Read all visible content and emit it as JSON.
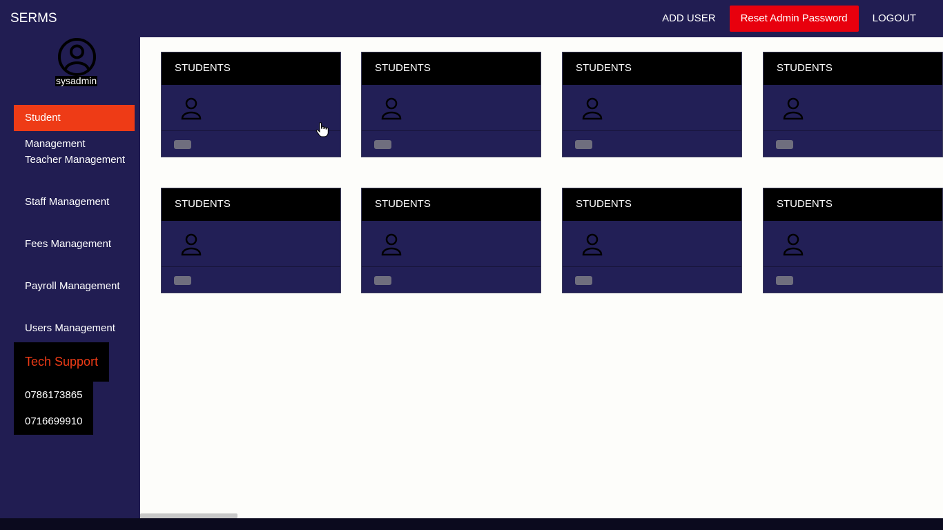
{
  "app": {
    "brand": "SERMS"
  },
  "header": {
    "add_user": "ADD USER",
    "reset_password": "Reset Admin Password",
    "logout": "LOGOUT"
  },
  "sidebar": {
    "username": "sysadmin",
    "items": [
      {
        "label": "Student Management",
        "active": true
      },
      {
        "label": "Teacher Management"
      },
      {
        "label": "Staff Management"
      },
      {
        "label": "Fees Management"
      },
      {
        "label": "Payroll Management"
      },
      {
        "label": "Users Management"
      }
    ],
    "tech_support": {
      "title": "Tech Support",
      "phones": [
        "0786173865",
        "0716699910"
      ]
    }
  },
  "cards": [
    {
      "title": "STUDENTS",
      "icon": "user-icon"
    },
    {
      "title": "STUDENTS",
      "icon": "user-icon"
    },
    {
      "title": "STUDENTS",
      "icon": "user-icon"
    },
    {
      "title": "STUDENTS",
      "icon": "user-icon"
    },
    {
      "title": "STUDENTS",
      "icon": "user-icon"
    },
    {
      "title": "STUDENTS",
      "icon": "user-icon"
    },
    {
      "title": "STUDENTS",
      "icon": "user-icon"
    },
    {
      "title": "STUDENTS",
      "icon": "user-icon"
    }
  ],
  "colors": {
    "navy": "#211d52",
    "accent_red": "#ee3b16",
    "button_red": "#e8000d"
  }
}
